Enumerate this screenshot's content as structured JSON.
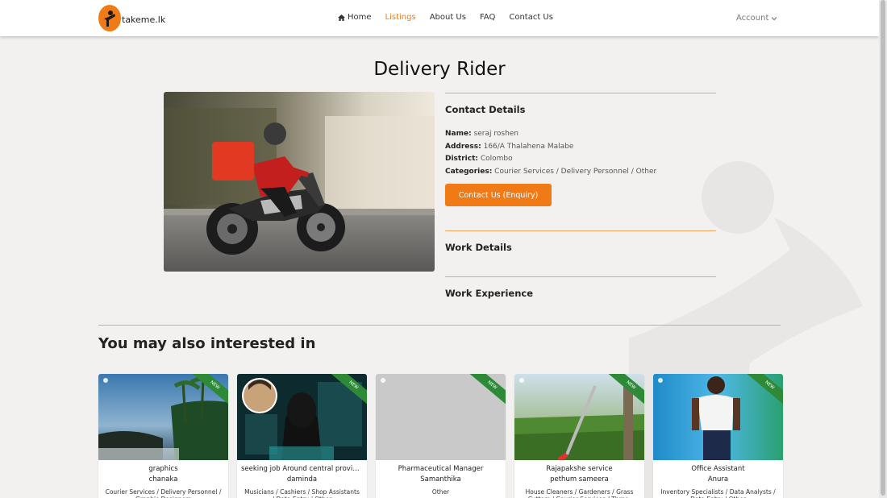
{
  "header": {
    "logo_text": "takeme.lk",
    "nav": [
      {
        "label": "Home",
        "active": false
      },
      {
        "label": "Listings",
        "active": true
      },
      {
        "label": "About Us",
        "active": false
      },
      {
        "label": "FAQ",
        "active": false
      },
      {
        "label": "Contact Us",
        "active": false
      }
    ],
    "account_label": "Account"
  },
  "colors": {
    "accent": "#f07b16",
    "new_ribbon": "#2f8a38",
    "background": "#f3f1ef"
  },
  "listing": {
    "title": "Delivery Rider",
    "contact_heading": "Contact Details",
    "name_label": "Name:",
    "name": "seraj roshen",
    "address_label": "Address:",
    "address": "166/A Thalahena Malabe",
    "district_label": "District:",
    "district": "Colombo",
    "categories_label": "Categories:",
    "categories": "Courier Services / Delivery Personnel / Other",
    "contact_button": "Contact Us (Enquiry)",
    "work_details_heading": "Work Details",
    "work_experience_heading": "Work Experience"
  },
  "related": {
    "heading": "You may also interested in",
    "badge": "NEW",
    "cards": [
      {
        "title": "graphics",
        "name": "chanaka",
        "categories": "Courier Services / Delivery Personnel / Graphic Designers"
      },
      {
        "title": "seeking job Around central province",
        "name": "daminda",
        "categories": "Musicians / Cashiers / Shop Assistants / Data Entry / Other"
      },
      {
        "title": "Pharmaceutical Manager",
        "name": "Samanthika",
        "categories": "Other"
      },
      {
        "title": "Rajapakshe service",
        "name": "pethum sameera",
        "categories": "House Cleaners / Gardeners / Grass Cutters / Courier Services / Three-"
      },
      {
        "title": "Office Assistant",
        "name": "Anura",
        "categories": "Inventory Specialists / Data Analysts / Data Entry / Other"
      }
    ]
  }
}
